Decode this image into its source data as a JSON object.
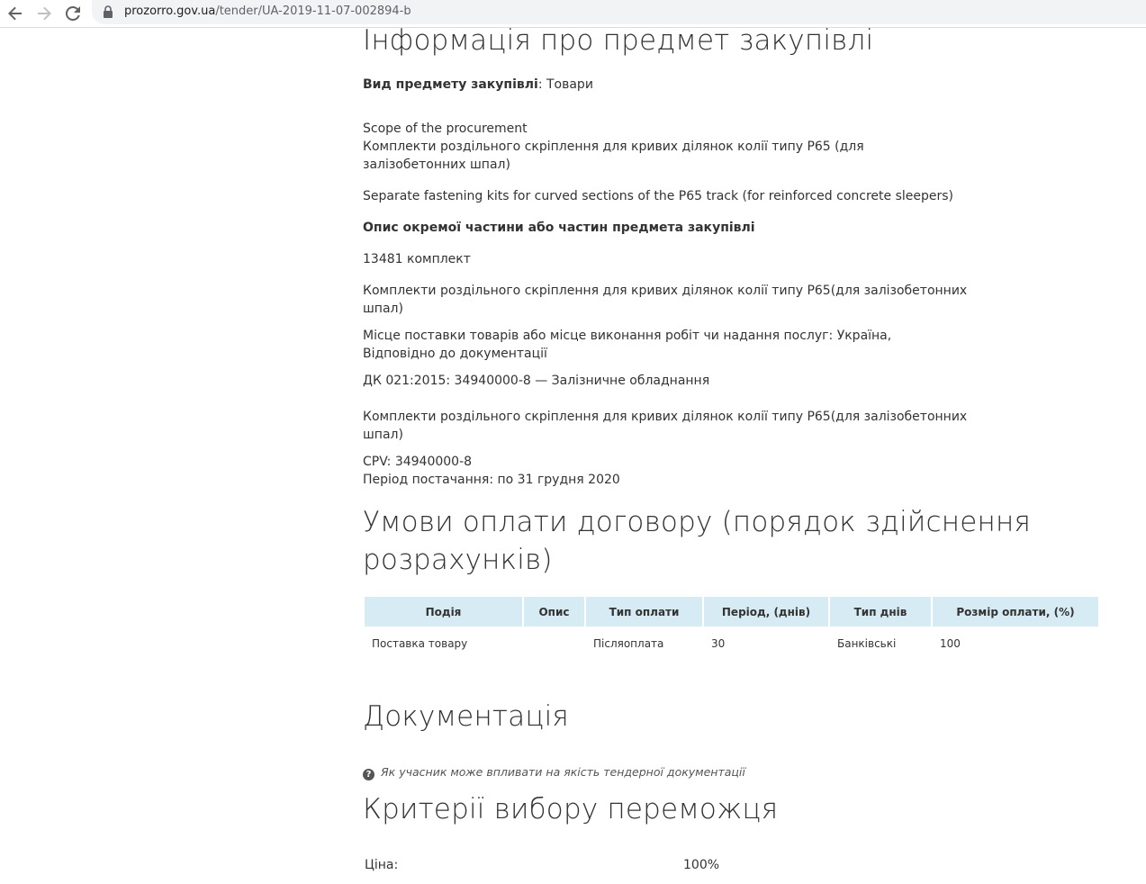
{
  "browser": {
    "url_host": "prozorro.gov.ua",
    "url_path": "/tender/UA-2019-11-07-002894-b"
  },
  "subject": {
    "heading": "Інформація про предмет закупівлі",
    "kind_label": "Вид предмету закупівлі",
    "kind_value": ": Товари",
    "scope_label": "Scope of the procurement",
    "scope_ua_line1": "Комплекти роздільного скріплення для кривих ділянок колії типу Р65 (для",
    "scope_ua_line2": "залізобетонних шпал)",
    "scope_en": "Separate fastening kits for curved sections of the P65 track (for reinforced concrete sleepers)",
    "lots_heading": "Опис окремої частини або частин предмета закупівлі",
    "quantity": "13481 комплект",
    "item1_line1": "Комплекти роздільного скріплення для кривих ділянок колії типу Р65(для залізобетонних",
    "item1_line2": "шпал)",
    "delivery_line1": "Місце поставки товарів або місце виконання робіт чи надання послуг: Україна,",
    "delivery_line2": "Відповідно до документації",
    "dk_code": "ДК 021:2015: 34940000-8 — Залізничне обладнання",
    "item2_line1": "Комплекти роздільного скріплення для кривих ділянок колії типу Р65(для залізобетонних",
    "item2_line2": "шпал)",
    "cpv": "CPV: 34940000-8",
    "period": "Період постачання: по 31 грудня 2020"
  },
  "payment": {
    "heading_line1": "Умови оплати договору (порядок здійснення",
    "heading_line2": "розрахунків)",
    "columns": [
      "Подія",
      "Опис",
      "Тип оплати",
      "Період, (днів)",
      "Тип днів",
      "Розмір оплати, (%)"
    ],
    "rows": [
      [
        "Поставка товару",
        "",
        "Післяоплата",
        "30",
        "Банківські",
        "100"
      ]
    ]
  },
  "documentation": {
    "heading": "Документація",
    "hint": "Як учасник може впливати на якість тендерної документації",
    "hint_icon": "question-circle-icon"
  },
  "criteria": {
    "heading": "Критерії вибору переможця",
    "price_label": "Ціна:",
    "price_value": "100%"
  }
}
